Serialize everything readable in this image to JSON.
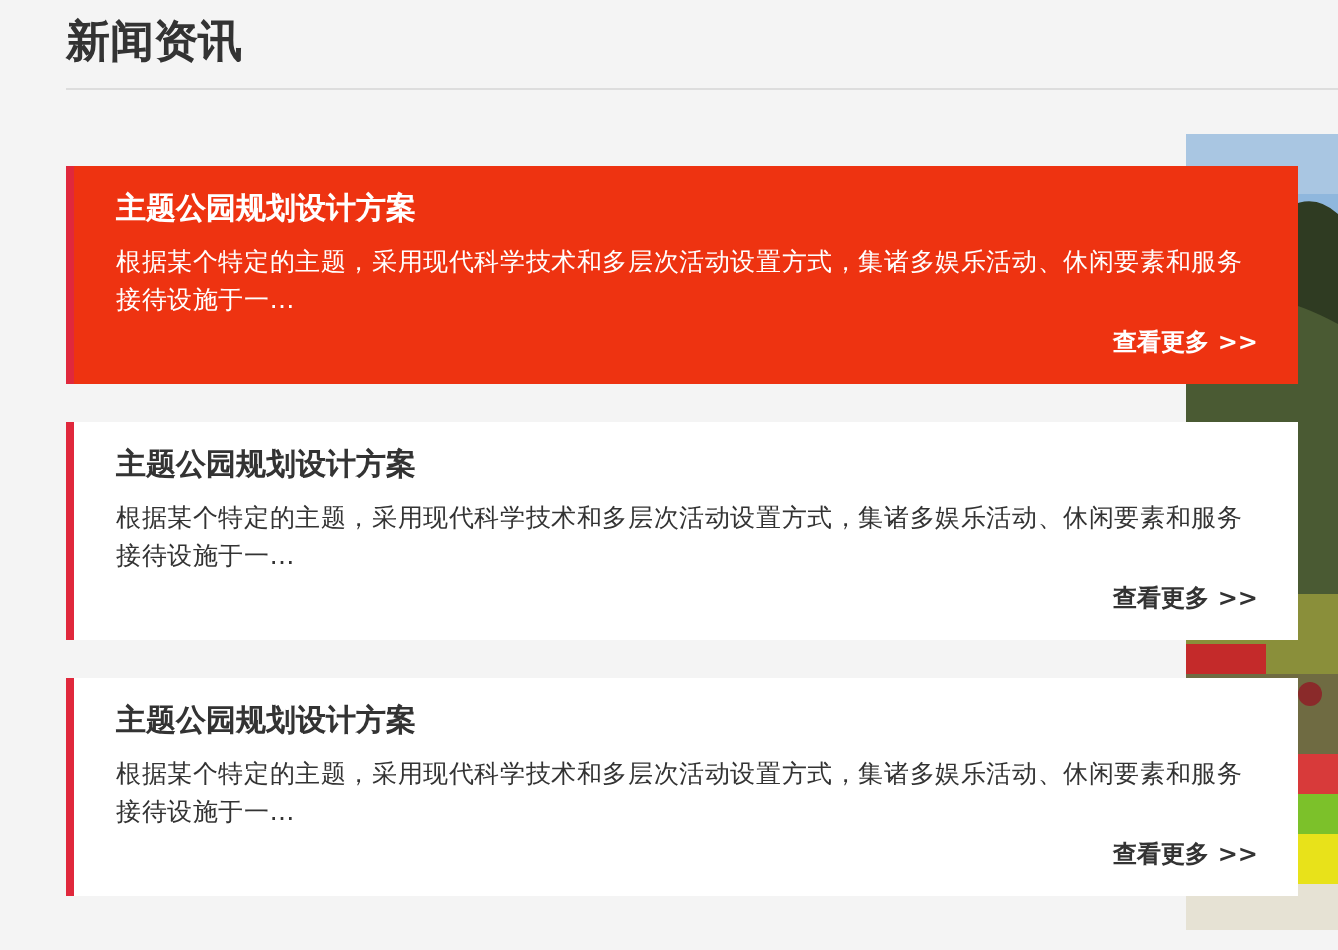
{
  "heading": "新闻资讯",
  "news": [
    {
      "title": "主题公园规划设计方案",
      "summary": "根据某个特定的主题，采用现代科学技术和多层次活动设置方式，集诸多娱乐活动、休闲要素和服务接待设施于一…",
      "more": "查看更多 >>",
      "selected": true
    },
    {
      "title": "主题公园规划设计方案",
      "summary": "根据某个特定的主题，采用现代科学技术和多层次活动设置方式，集诸多娱乐活动、休闲要素和服务接待设施于一…",
      "more": "查看更多 >>",
      "selected": false
    },
    {
      "title": "主题公园规划设计方案",
      "summary": "根据某个特定的主题，采用现代科学技术和多层次活动设置方式，集诸多娱乐活动、休闲要素和服务接待设施于一…",
      "more": "查看更多 >>",
      "selected": false
    }
  ]
}
